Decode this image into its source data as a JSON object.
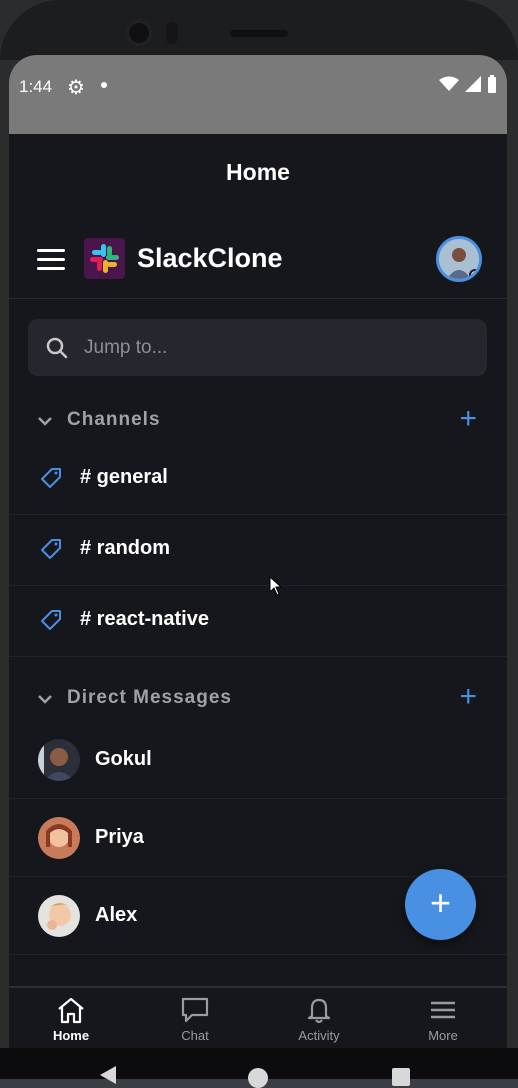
{
  "status_bar": {
    "time": "1:44"
  },
  "header": {
    "title": "Home"
  },
  "app_bar": {
    "brand": "SlackClone"
  },
  "search": {
    "placeholder": "Jump to..."
  },
  "channels": {
    "label": "Channels",
    "items": [
      "# general",
      "# random",
      "# react-native"
    ]
  },
  "direct_messages": {
    "label": "Direct Messages",
    "items": [
      "Gokul",
      "Priya",
      "Alex"
    ]
  },
  "tabs": [
    {
      "label": "Home",
      "icon": "home-icon",
      "active": true
    },
    {
      "label": "Chat",
      "icon": "chat-icon",
      "active": false
    },
    {
      "label": "Activity",
      "icon": "bell-icon",
      "active": false
    },
    {
      "label": "More",
      "icon": "menu-icon",
      "active": false
    }
  ],
  "colors": {
    "accent": "#4a90e2",
    "background": "#16171c",
    "brand_logo_bg": "#4a154b"
  }
}
